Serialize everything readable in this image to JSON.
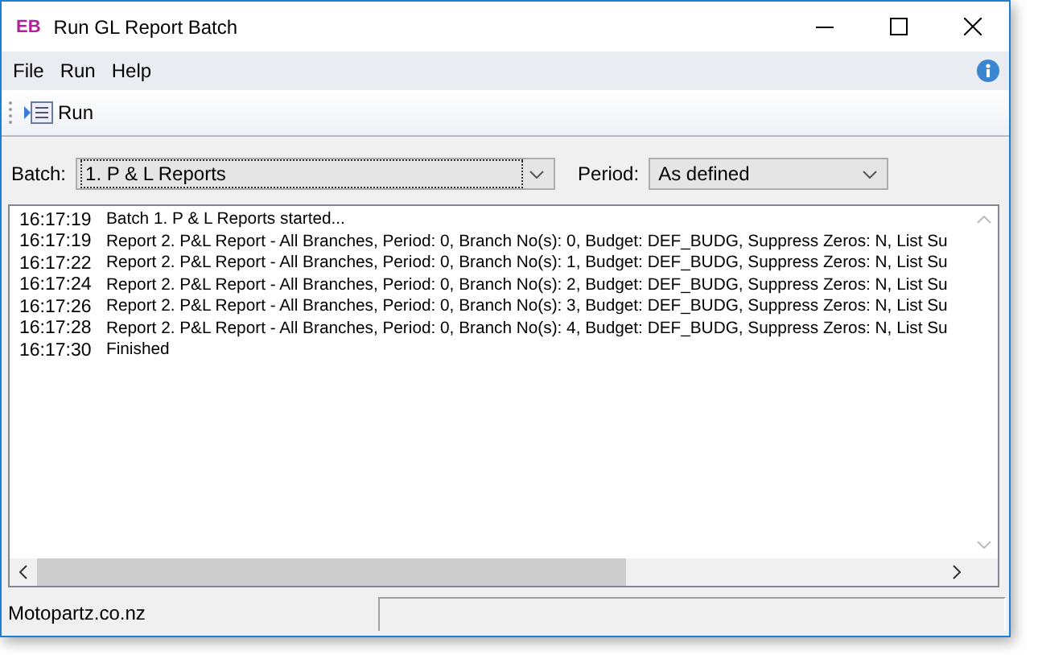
{
  "window": {
    "logo": "EB",
    "title": "Run GL Report Batch"
  },
  "menu": [
    {
      "label": "File"
    },
    {
      "label": "Run"
    },
    {
      "label": "Help"
    }
  ],
  "toolbar": [
    {
      "label": "Run"
    }
  ],
  "batch": {
    "label": "Batch:",
    "value": "1. P & L Reports",
    "focused": true
  },
  "period": {
    "label": "Period:",
    "value": "As defined"
  },
  "log": [
    {
      "time": "16:17:19",
      "message": "Batch 1. P & L Reports started..."
    },
    {
      "time": "16:17:19",
      "message": "Report 2. P&L Report - All Branches, Period: 0, Branch No(s): 0, Budget: DEF_BUDG, Suppress Zeros: N, List Su"
    },
    {
      "time": "16:17:22",
      "message": "Report 2. P&L Report - All Branches, Period: 0, Branch No(s): 1, Budget: DEF_BUDG, Suppress Zeros: N, List Su"
    },
    {
      "time": "16:17:24",
      "message": "Report 2. P&L Report - All Branches, Period: 0, Branch No(s): 2, Budget: DEF_BUDG, Suppress Zeros: N, List Su"
    },
    {
      "time": "16:17:26",
      "message": "Report 2. P&L Report - All Branches, Period: 0, Branch No(s): 3, Budget: DEF_BUDG, Suppress Zeros: N, List Su"
    },
    {
      "time": "16:17:28",
      "message": "Report 2. P&L Report - All Branches, Period: 0, Branch No(s): 4, Budget: DEF_BUDG, Suppress Zeros: N, List Su"
    },
    {
      "time": "16:17:30",
      "message": "Finished"
    }
  ],
  "status_bar": {
    "company": "Motopartz.co.nz"
  }
}
